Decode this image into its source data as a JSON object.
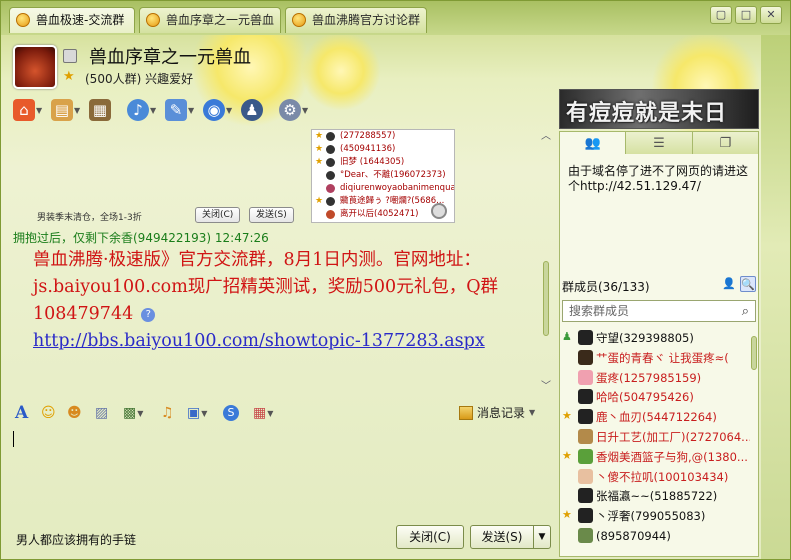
{
  "tabs": [
    {
      "label": "兽血极速-交流群",
      "active": true
    },
    {
      "label": "兽血序章之一元兽血",
      "active": false
    },
    {
      "label": "兽血沸腾官方讨论群",
      "active": false
    }
  ],
  "window_buttons": {
    "minimize": "▢",
    "restore": "□",
    "close": "✕"
  },
  "header": {
    "title": "兽血序章之一元兽血",
    "subtitle": "(500人群) 兴趣爱好"
  },
  "chat": {
    "embedded": {
      "caption": "男装季末清仓，全场1-3折",
      "close_btn": "关闭(C)",
      "send_btn": "发送(S)",
      "rows": [
        "(277288557)",
        "(450941136)",
        "旧梦 (1644305)",
        "°Dear、不離(196072373)",
        "diqiurenwoyaobanimenquanb...",
        "覹莨途歸ぅ ?嘲爛?(5686...",
        "离开以后(4052471)"
      ]
    },
    "message_header": "拥抱过后，仅剩下余香(949422193)  12:47:26",
    "message_text": "兽血沸腾·极速版》官方交流群，8月1日内测。官网地址：js.baiyou100.com现广招精英测试，奖励500元礼包，Q群108479744",
    "message_link": "http://bbs.baiyou100.com/showtopic-1377283.aspx"
  },
  "input_toolbar": {
    "history_label": "消息记录"
  },
  "bottom": {
    "status_text": "男人都应该拥有的手链",
    "close_label": "关闭(C)",
    "send_label": "发送(S)",
    "send_arrow": "▼"
  },
  "right": {
    "banner_text": "有痘痘就是末日",
    "notice": "由于域名停了进不了网页的请进这个http://42.51.129.47/",
    "members_header": "群成员(36/133)",
    "search_placeholder": "搜索群成员",
    "members": [
      {
        "name": "守望(329398805)",
        "color": "#111111",
        "badge": "person",
        "avatar": "#222222"
      },
      {
        "name": "艹蛋的青春ヾ 让我蛋疼≈(",
        "color": "#c81e1e",
        "badge": "",
        "avatar": "#3a2a1a"
      },
      {
        "name": "蛋疼(1257985159)",
        "color": "#c81e1e",
        "badge": "",
        "avatar": "#f0a0b0"
      },
      {
        "name": "哈哈(504795426)",
        "color": "#c81e1e",
        "badge": "",
        "avatar": "#222222"
      },
      {
        "name": "鹿丶血刃(544712264)",
        "color": "#c81e1e",
        "badge": "star",
        "avatar": "#222222"
      },
      {
        "name": "日升工艺(加工厂)(2727064...",
        "color": "#c81e1e",
        "badge": "",
        "avatar": "#b38a4a"
      },
      {
        "name": "香烟美酒篮子与狗,@(1380...",
        "color": "#c81e1e",
        "badge": "star",
        "avatar": "#5aa03a"
      },
      {
        "name": "丶傻不拉叽(100103434)",
        "color": "#c81e1e",
        "badge": "",
        "avatar": "#e8c0a0"
      },
      {
        "name": "张福瀛~~(51885722)",
        "color": "#111111",
        "badge": "",
        "avatar": "#222222"
      },
      {
        "name": "丶浮奢(799055083)",
        "color": "#111111",
        "badge": "star",
        "avatar": "#222222"
      },
      {
        "name": "(895870944)",
        "color": "#111111",
        "badge": "",
        "avatar": "#6a8a4a"
      }
    ]
  }
}
